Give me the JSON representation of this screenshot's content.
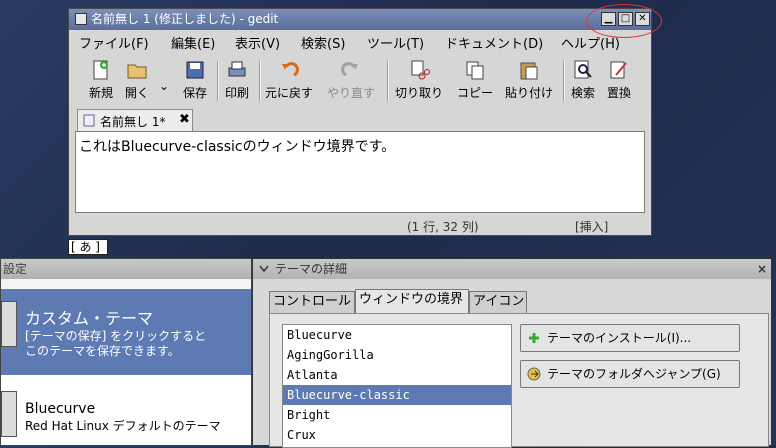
{
  "gedit": {
    "title": "名前無し 1 (修正しました) - gedit",
    "menu": [
      "ファイル(F)",
      "編集(E)",
      "表示(V)",
      "検索(S)",
      "ツール(T)",
      "ドキュメント(D)",
      "ヘルプ(H)"
    ],
    "toolbar": {
      "new": "新規",
      "open": "開く",
      "save": "保存",
      "print": "印刷",
      "undo": "元に戻す",
      "redo": "やり直す",
      "cut": "切り取り",
      "copy": "コピー",
      "paste": "貼り付け",
      "find": "検索",
      "replace": "置換"
    },
    "tab_label": "名前無し 1*",
    "tab_close": "✖",
    "content": "これはBluecurve-classicのウィンドウ境界です。",
    "status_position": "(1 行, 32 列)",
    "status_mode": "[挿入]"
  },
  "input_method": "[ あ ]",
  "prefs": {
    "title": "設定",
    "items": [
      {
        "name": "カスタム・テーマ",
        "desc1": "[テーマの保存] をクリックすると",
        "desc2": "このテーマを保存できます。"
      },
      {
        "name": "Bluecurve",
        "desc1": "Red Hat Linux デフォルトのテーマ"
      }
    ]
  },
  "details": {
    "title": "テーマの詳細",
    "tabs": [
      "コントロール",
      "ウィンドウの境界",
      "アイコン"
    ],
    "themes": [
      "Bluecurve",
      "AgingGorilla",
      "Atlanta",
      "Bluecurve-classic",
      "Bright",
      "Crux"
    ],
    "selected_theme": "Bluecurve-classic",
    "install_button": "テーマのインストール(I)...",
    "folder_button": "テーマのフォルダへジャンプ(G)"
  },
  "colors": {
    "selection": "#5e7ab3",
    "annotation_circle": "#dd3333"
  }
}
